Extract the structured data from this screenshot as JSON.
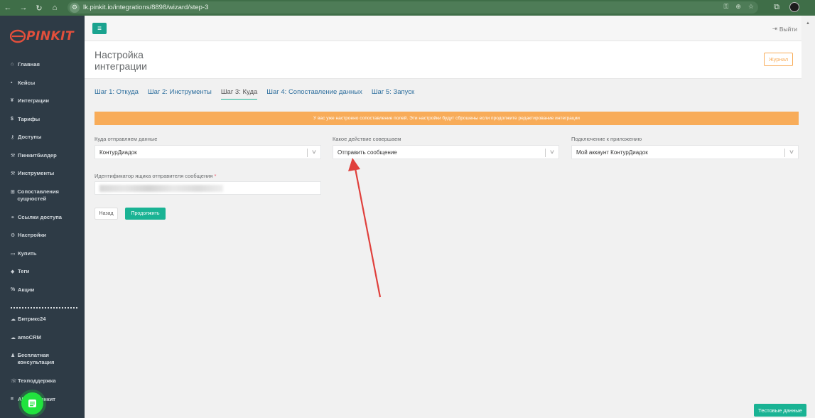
{
  "browser": {
    "url": "lk.pinkit.io/integrations/8898/wizard/step-3"
  },
  "brand": {
    "logo_text": "PINKIT",
    "accent": "#e24f3c"
  },
  "colors": {
    "primary": "#1ab394",
    "warning": "#f8ac59",
    "sidebar": "#2e3b46",
    "annotation_arrow": "#e0403c"
  },
  "sidebar": {
    "items": [
      {
        "icon": "home-icon",
        "glyph": "⌂",
        "label": "Главная"
      },
      {
        "icon": "briefcase-icon",
        "glyph": "▪",
        "label": "Кейсы"
      },
      {
        "icon": "plug-icon",
        "glyph": "¥",
        "label": "Интеграции"
      },
      {
        "icon": "dollar-icon",
        "glyph": "$",
        "label": "Тарифы"
      },
      {
        "icon": "key-icon",
        "glyph": "⚷",
        "label": "Доступы"
      },
      {
        "icon": "wrench-icon",
        "glyph": "⚒",
        "label": "Пинкитбилдер"
      },
      {
        "icon": "wrench-icon",
        "glyph": "⚒",
        "label": "Инструменты"
      },
      {
        "icon": "table-icon",
        "glyph": "⊞",
        "label": "Сопоставления сущностей"
      },
      {
        "icon": "link-icon",
        "glyph": "⚭",
        "label": "Ссылки доступа"
      },
      {
        "icon": "gears-icon",
        "glyph": "⚙",
        "label": "Настройки"
      },
      {
        "icon": "money-icon",
        "glyph": "▭",
        "label": "Купить"
      },
      {
        "icon": "tag-icon",
        "glyph": "◆",
        "label": "Теги"
      },
      {
        "icon": "percent-icon",
        "glyph": "%",
        "label": "Акции"
      }
    ],
    "bottom_items": [
      {
        "icon": "cloud-icon",
        "glyph": "☁",
        "label": "Битрикс24"
      },
      {
        "icon": "cloud-icon",
        "glyph": "☁",
        "label": "amoCRM"
      },
      {
        "icon": "user-icon",
        "glyph": "♟",
        "label": "Бесплатная консультация"
      },
      {
        "icon": "support-icon",
        "glyph": "☏",
        "label": "Техподдержка"
      },
      {
        "icon": "code-icon",
        "glyph": "⌗",
        "label": "API по Пинкит"
      }
    ]
  },
  "topbar": {
    "logout_label": "Выйти"
  },
  "header": {
    "title": "Настройка интеграции",
    "journal_label": "Журнал"
  },
  "tabs": [
    {
      "label": "Шаг 1: Откуда",
      "active": false
    },
    {
      "label": "Шаг 2: Инструменты",
      "active": false
    },
    {
      "label": "Шаг 3: Куда",
      "active": true
    },
    {
      "label": "Шаг 4: Сопоставление данных",
      "active": false
    },
    {
      "label": "Шаг 5: Запуск",
      "active": false
    }
  ],
  "alert": {
    "text": "У вас уже настроено сопоставление полей. Эти настройки будут сброшены если продолжите редактирование интеграции"
  },
  "form": {
    "destination": {
      "label": "Куда отправляем данные",
      "value": "КонтурДиадок"
    },
    "action": {
      "label": "Какое действие совершаем",
      "value": "Отправить сообщение"
    },
    "connection": {
      "label": "Подключение к приложению",
      "value": "Мой аккаунт КонтурДиадок"
    },
    "sender_box": {
      "label": "Идентификатор ящика отправителя сообщения",
      "required_mark": "*"
    },
    "back_label": "Назад",
    "next_label": "Продолжить"
  },
  "test_data_label": "Тестовые данные"
}
